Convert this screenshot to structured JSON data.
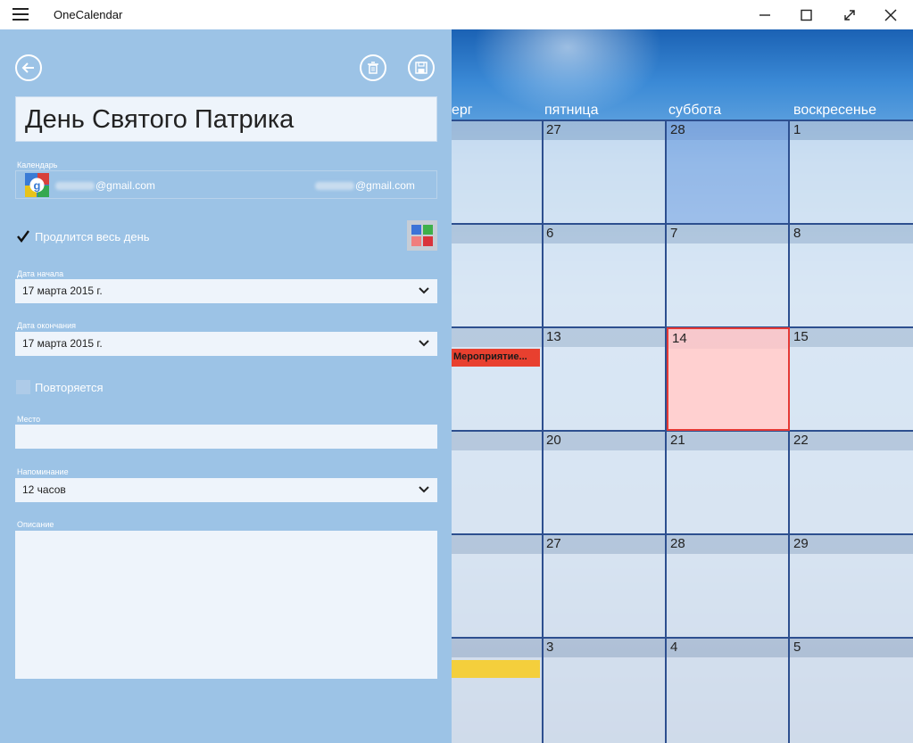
{
  "app": {
    "title": "OneCalendar"
  },
  "window_icons": [
    "menu-icon",
    "minimize-icon",
    "maximize-icon",
    "fullscreen-icon",
    "close-icon"
  ],
  "event": {
    "title": "День Святого Патрика",
    "calendar_label": "Календарь",
    "calendar_account": "@gmail.com",
    "calendar_account_right": "@gmail.com",
    "all_day_label": "Продлится весь день",
    "all_day_checked": true,
    "start_label": "Дата начала",
    "start_value": "17 марта 2015 г.",
    "end_label": "Дата окончания",
    "end_value": "17 марта 2015 г.",
    "repeat_label": "Повторяется",
    "repeat_checked": false,
    "location_label": "Место",
    "location_value": "",
    "reminder_label": "Напоминание",
    "reminder_value": "12 часов",
    "description_label": "Описание",
    "description_value": "",
    "color_swatches": [
      "#3b73d8",
      "#3db04a",
      "#f07d7d",
      "#d9333b"
    ]
  },
  "calendar": {
    "day_headers": [
      "ерг",
      "пятница",
      "суббота",
      "воскресенье"
    ],
    "weeks": [
      [
        "",
        "27",
        "28",
        "1"
      ],
      [
        "",
        "6",
        "7",
        "8"
      ],
      [
        "",
        "13",
        "14",
        "15"
      ],
      [
        "",
        "20",
        "21",
        "22"
      ],
      [
        "",
        "27",
        "28",
        "29"
      ],
      [
        "",
        "3",
        "4",
        "5"
      ]
    ],
    "today": "14",
    "events": [
      {
        "label": "Мероприятие...",
        "color": "#e8402f"
      },
      {
        "label": "",
        "color": "#f4cf3c"
      }
    ],
    "colors": {
      "grid_line": "#2d4f8f",
      "today_fill": "#ffd0d0",
      "today_border": "#e53935"
    }
  }
}
